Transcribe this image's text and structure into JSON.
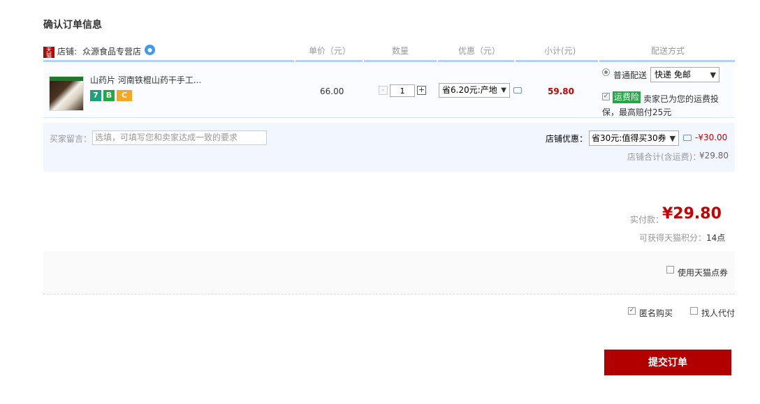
{
  "page_title": "确认订单信息",
  "header": {
    "shop_label": "店铺:",
    "shop_name": "众源食品专营店",
    "tmall_icon_text": "天猫",
    "columns": {
      "unit_price": "单价（元）",
      "quantity": "数量",
      "discount": "优惠（元）",
      "subtotal": "小计(元)",
      "delivery": "配送方式"
    }
  },
  "item": {
    "title": "山药片 河南铁棍山药干手工...",
    "badges": [
      "7",
      "B",
      "C"
    ],
    "unit_price": "66.00",
    "quantity": "1",
    "qty_minus": "-",
    "qty_plus": "+",
    "discount_selected": "省6.20元:产地",
    "subtotal": "59.80",
    "delivery": {
      "option_label": "普通配送",
      "method_selected": "快递 免邮",
      "insurance_badge": "运费险",
      "insurance_text_1": "卖家已为您的运费投",
      "insurance_text_2": "保，最高赔付25元"
    }
  },
  "note": {
    "label": "买家留言：",
    "placeholder": "选填，可填写您和卖家达成一致的要求"
  },
  "shop_coupon": {
    "label": "店铺优惠：",
    "selected": "省30元:值得买30券",
    "amount": "-¥30.00",
    "shop_total_label": "店铺合计(含运费)：",
    "shop_total_value": "¥29.80"
  },
  "totals": {
    "pay_label": "实付款：",
    "pay_amount": "¥29.80",
    "points_label": "可获得天猫积分：",
    "points_value": "14点"
  },
  "options": {
    "tmall_coupon_label": "使用天猫点券",
    "anonymous_label": "匿名购买",
    "proxy_label": "找人代付"
  },
  "submit_label": "提交订单",
  "colors": {
    "accent_red": "#c40000",
    "submit_bg": "#b20000",
    "header_bar": "#b2d1ff"
  }
}
